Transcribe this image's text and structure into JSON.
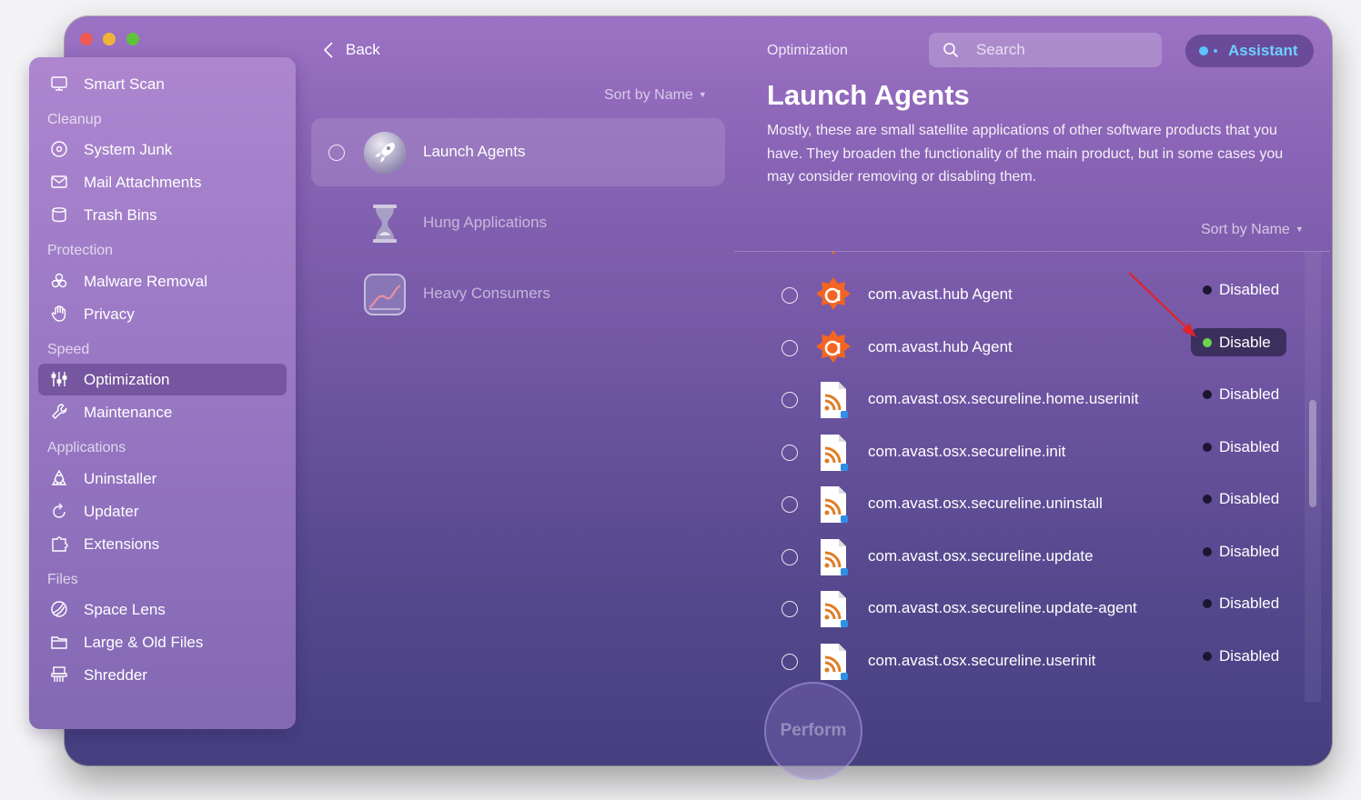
{
  "window_controls": {
    "close": "close",
    "minimize": "minimize",
    "zoom": "zoom"
  },
  "sidebar": {
    "items": [
      {
        "label": "Smart Scan",
        "icon": "monitor-icon"
      },
      {
        "section": "Cleanup"
      },
      {
        "label": "System Junk",
        "icon": "disc-icon"
      },
      {
        "label": "Mail Attachments",
        "icon": "envelope-icon"
      },
      {
        "label": "Trash Bins",
        "icon": "trash-icon"
      },
      {
        "section": "Protection"
      },
      {
        "label": "Malware Removal",
        "icon": "biohazard-icon"
      },
      {
        "label": "Privacy",
        "icon": "hand-icon"
      },
      {
        "section": "Speed"
      },
      {
        "label": "Optimization",
        "icon": "sliders-icon",
        "active": true
      },
      {
        "label": "Maintenance",
        "icon": "wrench-icon"
      },
      {
        "section": "Applications"
      },
      {
        "label": "Uninstaller",
        "icon": "apps-icon"
      },
      {
        "label": "Updater",
        "icon": "update-icon"
      },
      {
        "label": "Extensions",
        "icon": "puzzle-icon"
      },
      {
        "section": "Files"
      },
      {
        "label": "Space Lens",
        "icon": "lens-icon"
      },
      {
        "label": "Large & Old Files",
        "icon": "folder-icon"
      },
      {
        "label": "Shredder",
        "icon": "shredder-icon"
      }
    ]
  },
  "middle": {
    "back_label": "Back",
    "sort_label": "Sort by Name",
    "categories": [
      {
        "label": "Launch Agents",
        "icon": "rocket-icon",
        "selected": true
      },
      {
        "label": "Hung Applications",
        "icon": "hourglass-icon"
      },
      {
        "label": "Heavy Consumers",
        "icon": "chart-icon"
      }
    ]
  },
  "header": {
    "crumb": "Optimization",
    "search_placeholder": "Search",
    "assistant_label": "Assistant"
  },
  "detail": {
    "title": "Launch Agents",
    "description": "Mostly, these are small satellite applications of other software products that you have. They broaden the functionality of the main product, but in some cases you may consider removing or disabling them.",
    "sort_label": "Sort by Name",
    "items": [
      {
        "name": "com.avast.hub Agent",
        "icon": "avast-icon",
        "status": "Disabled"
      },
      {
        "name": "com.avast.hub Agent",
        "icon": "avast-icon",
        "status": "Disable",
        "highlight": true
      },
      {
        "name": "com.avast.osx.secureline.home.userinit",
        "icon": "rss-doc-icon",
        "status": "Disabled"
      },
      {
        "name": "com.avast.osx.secureline.init",
        "icon": "rss-doc-icon",
        "status": "Disabled"
      },
      {
        "name": "com.avast.osx.secureline.uninstall",
        "icon": "rss-doc-icon",
        "status": "Disabled"
      },
      {
        "name": "com.avast.osx.secureline.update",
        "icon": "rss-doc-icon",
        "status": "Disabled"
      },
      {
        "name": "com.avast.osx.secureline.update-agent",
        "icon": "rss-doc-icon",
        "status": "Disabled"
      },
      {
        "name": "com.avast.osx.secureline.userinit",
        "icon": "rss-doc-icon",
        "status": "Disabled"
      }
    ]
  },
  "perform_label": "Perform",
  "colors": {
    "accent": "#6fd0ff",
    "enabled_dot": "#6cd34b",
    "avast_orange": "#f26522",
    "annotation_arrow": "#e0242b"
  }
}
